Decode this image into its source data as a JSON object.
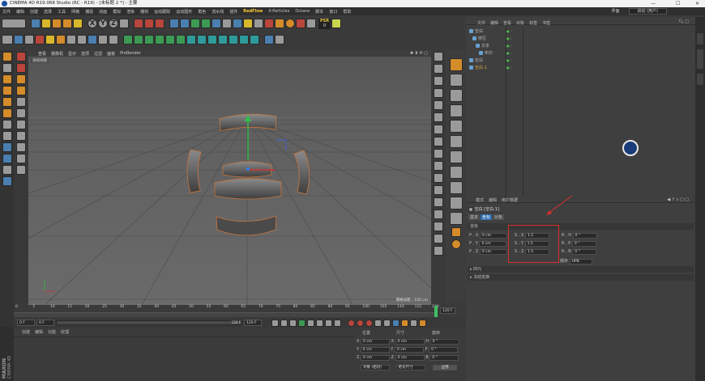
{
  "window": {
    "title": "CINEMA 4D R19.068 Studio (RC - R19) - [未标题 2 *] - 主要",
    "minimize": "—",
    "maximize": "☐",
    "close": "✕"
  },
  "menubar": {
    "items": [
      "文件",
      "编辑",
      "创建",
      "选择",
      "工具",
      "网格",
      "捕捉",
      "动画",
      "模拟",
      "渲染",
      "雕刻",
      "运动跟踪",
      "运动图形",
      "角色",
      "流水线",
      "插件",
      "RedFlow",
      "X-Particles",
      "Octane",
      "脚本",
      "窗口",
      "帮助"
    ],
    "highlight": "RedFlow",
    "layout_label": "界面",
    "layout_value": "启动 (用户)"
  },
  "toolbar_top": {
    "axis_x": "X",
    "axis_y": "Y",
    "axis_z": "Z",
    "psr_label": "PSR",
    "psr_value": "0"
  },
  "viewport": {
    "menu": [
      "查看",
      "摄像机",
      "显示",
      "选项",
      "过滤",
      "面板",
      "ProRender"
    ],
    "label": "透视视图",
    "scale": "网格间距 : 100 cm"
  },
  "timeline": {
    "ticks": [
      "0",
      "5",
      "10",
      "15",
      "20",
      "25",
      "30",
      "35",
      "40",
      "45",
      "50",
      "55",
      "60",
      "65",
      "70",
      "75",
      "80",
      "85",
      "90",
      "95",
      "100",
      "105",
      "110",
      "115",
      "120"
    ],
    "end_frame": "120 F",
    "current": "0 F",
    "range_start": "0 F",
    "range_end": "120 F",
    "range_mid": "120 F"
  },
  "material": {
    "menu": [
      "创建",
      "编辑",
      "功能",
      "纹理"
    ]
  },
  "coords": {
    "headers": [
      "位置",
      "尺寸",
      "旋转"
    ],
    "rows": [
      {
        "axis": "X",
        "pos": "0 cm",
        "size_axis": "X",
        "size": "0 cm",
        "rot_axis": "H",
        "rot": "0 °"
      },
      {
        "axis": "Y",
        "pos": "0 cm",
        "size_axis": "Y",
        "size": "0 cm",
        "rot_axis": "P",
        "rot": "0 °"
      },
      {
        "axis": "Z",
        "pos": "0 cm",
        "size_axis": "Z",
        "size": "0 cm",
        "rot_axis": "B",
        "rot": "0 °"
      }
    ],
    "mode": "对象 (相对)",
    "size_mode": "绝对尺寸",
    "apply": "应用"
  },
  "maxon": {
    "brand": "MAXON",
    "product": "CINEMA 4D"
  },
  "object_manager": {
    "menu": [
      "文件",
      "编辑",
      "查看",
      "对象",
      "标签",
      "书签"
    ],
    "objects": [
      {
        "name": "空白",
        "indent": 0,
        "color": "#bdbdbd"
      },
      {
        "name": "挤压",
        "indent": 1,
        "color": "#bdbdbd"
      },
      {
        "name": "文本",
        "indent": 2,
        "color": "#bdbdbd"
      },
      {
        "name": "布尔",
        "indent": 3,
        "color": "#bdbdbd"
      },
      {
        "name": "空白",
        "indent": 0,
        "color": "#bdbdbd"
      },
      {
        "name": "空白.1",
        "indent": 0,
        "color": "#e0b040"
      }
    ]
  },
  "attribute_manager": {
    "menu": [
      "模式",
      "编辑",
      "用户数据"
    ],
    "object_label": "空白 [空白.1]",
    "tabs": [
      "基本",
      "坐标",
      "对象"
    ],
    "active_tab": "坐标",
    "section": "坐标",
    "rows": [
      {
        "p": "P . X",
        "pv": "0 cm",
        "s": "S . X",
        "sv": "1.5",
        "r": "R . H",
        "rv": "0 °"
      },
      {
        "p": "P . Y",
        "pv": "0 cm",
        "s": "S . Y",
        "sv": "1.5",
        "r": "R . P",
        "rv": "0 °"
      },
      {
        "p": "P . Z",
        "pv": "0 cm",
        "s": "S . Z",
        "sv": "1.5",
        "r": "R . B",
        "rv": "0 °"
      }
    ],
    "order_label": "顺序",
    "order_value": "HPB",
    "collapsed": [
      "四元",
      "冻结变换"
    ]
  },
  "colors": {
    "accent": "#e0b040",
    "annotation": "#d9302c",
    "bg": "#3a3a3a",
    "viewport": "#5c5c5c"
  }
}
